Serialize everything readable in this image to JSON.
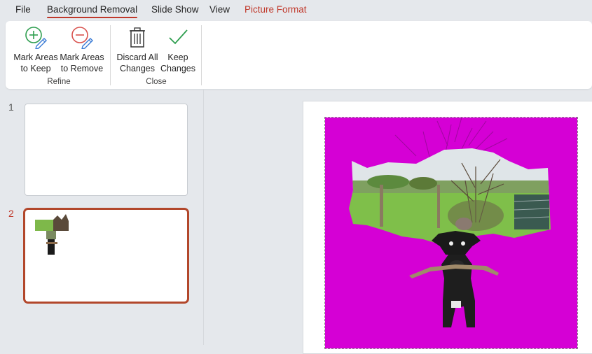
{
  "tabs": [
    {
      "label": "File"
    },
    {
      "label": "Background Removal"
    },
    {
      "label": "Slide Show"
    },
    {
      "label": "View"
    },
    {
      "label": "Picture Format"
    }
  ],
  "ribbon": {
    "refine": {
      "group_label": "Refine",
      "mark_keep": {
        "line1": "Mark Areas",
        "line2": "to Keep",
        "icon": "plus-pencil-icon"
      },
      "mark_remove": {
        "line1": "Mark Areas",
        "line2": "to Remove",
        "icon": "minus-pencil-icon"
      }
    },
    "close": {
      "group_label": "Close",
      "discard": {
        "line1": "Discard All",
        "line2": "Changes",
        "icon": "trash-icon"
      },
      "keep": {
        "line1": "Keep",
        "line2": "Changes",
        "icon": "checkmark-icon"
      }
    }
  },
  "slides": [
    {
      "number": "1"
    },
    {
      "number": "2"
    }
  ],
  "colors": {
    "accent": "#c0392b",
    "removal_overlay": "#e000e0",
    "keep_green": "#2e9e4f",
    "remove_red": "#d9534f"
  }
}
